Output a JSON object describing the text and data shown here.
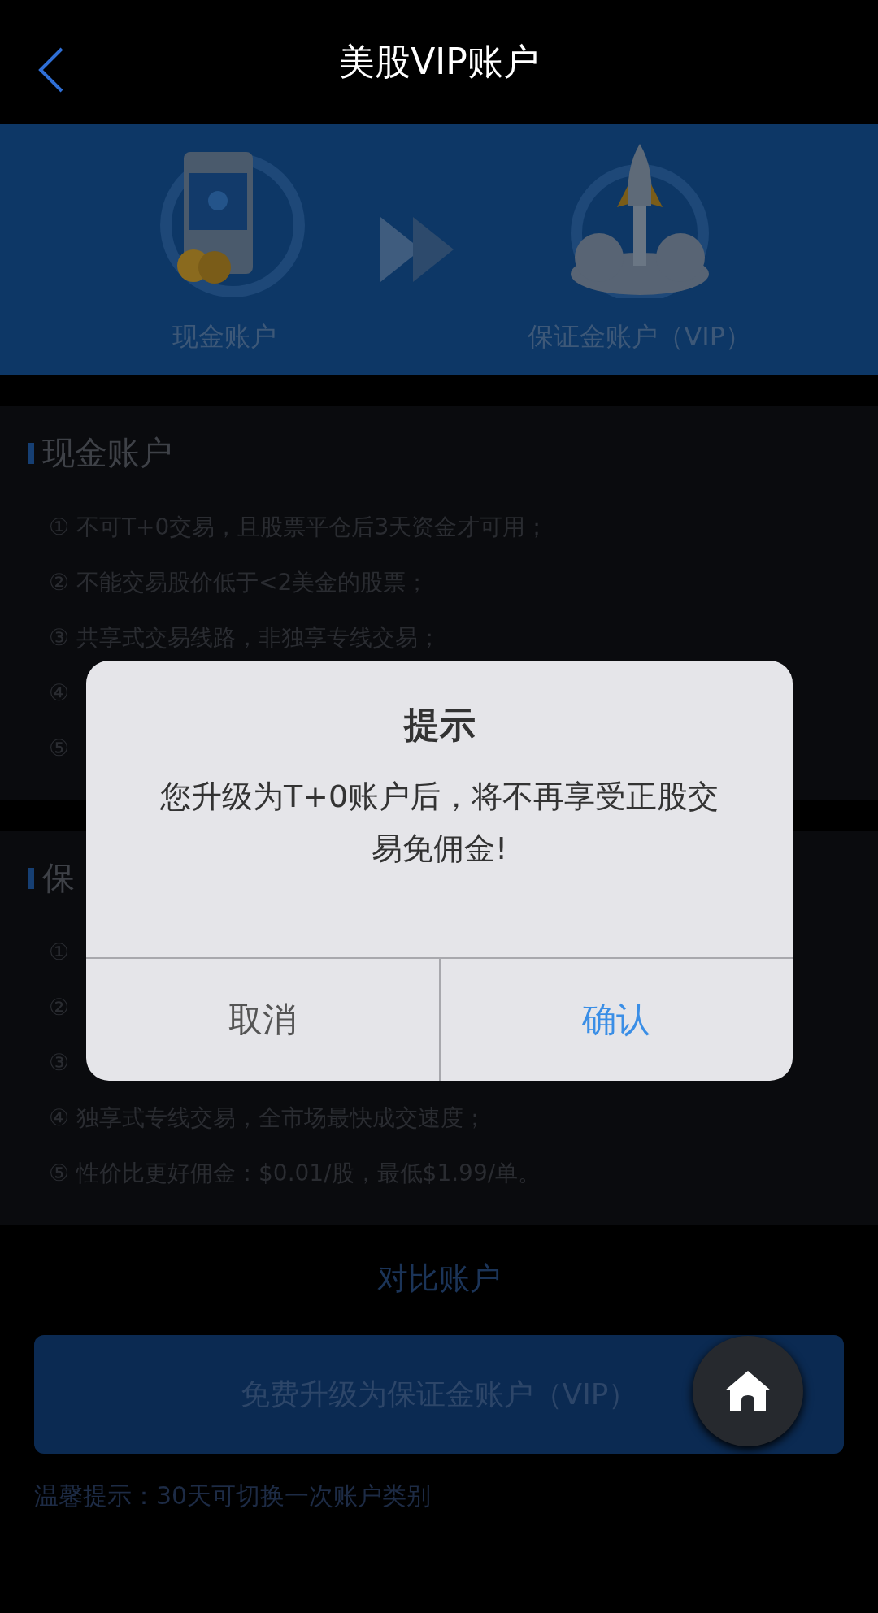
{
  "nav": {
    "title": "美股VIP账户"
  },
  "banner": {
    "from_label": "现金账户",
    "to_label": "保证金账户（VIP）"
  },
  "sections": [
    {
      "heading": "现金账户",
      "items": [
        "① 不可T+0交易，且股票平仓后3天资金才可用；",
        "② 不能交易股价低于<2美金的股票；",
        "③ 共享式交易线路，非独享专线交易；",
        "④",
        "⑤"
      ]
    },
    {
      "heading": "保",
      "items": [
        "①",
        "②",
        "③",
        "④ 独享式专线交易，全市场最快成交速度；",
        "⑤ 性价比更好佣金：$0.01/股，最低$1.99/单。"
      ]
    }
  ],
  "compare_link": "对比账户",
  "upgrade_button": "免费升级为保证金账户（VIP）",
  "tip": "温馨提示：30天可切换一次账户类别",
  "dialog": {
    "title": "提示",
    "message": "您升级为T+0账户后，将不再享受正股交易免佣金!",
    "buttons": [
      {
        "label": "取消",
        "kind": "cancel"
      },
      {
        "label": "确认",
        "kind": "confirm"
      }
    ]
  }
}
